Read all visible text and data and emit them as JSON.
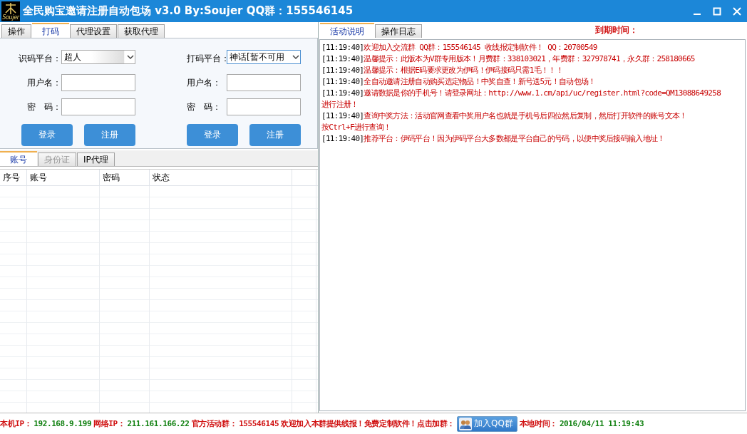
{
  "window": {
    "title": "全民购宝邀请注册自动包场 v3.0 By:Soujer QQ群：155546145",
    "logo_text": "Soujer"
  },
  "left_tabs": [
    {
      "label": "操作",
      "selected": false
    },
    {
      "label": "打码",
      "selected": true
    },
    {
      "label": "代理设置",
      "selected": false
    },
    {
      "label": "获取代理",
      "selected": false
    }
  ],
  "login_panels": [
    {
      "platform_label": "识码平台：",
      "platform_value": "超人",
      "username_label": "用户名：",
      "password_label": "密　码：",
      "buttons": [
        "登录",
        "注册"
      ]
    },
    {
      "platform_label": "打码平台：",
      "platform_value": "神话[暂不可用",
      "username_label": "用户名：",
      "password_label": "密　码：",
      "buttons": [
        "登录",
        "注册"
      ]
    }
  ],
  "record_tabs": [
    {
      "label": "账号",
      "selected": true,
      "disabled": false
    },
    {
      "label": "身份证",
      "selected": false,
      "disabled": true
    },
    {
      "label": "IP代理",
      "selected": false,
      "disabled": false
    }
  ],
  "table": {
    "columns": [
      "序号",
      "账号",
      "密码",
      "状态"
    ]
  },
  "right_tabs": [
    {
      "label": "活动说明",
      "selected": true
    },
    {
      "label": "操作日志",
      "selected": false
    }
  ],
  "expiry_label": "到期时间：",
  "log": [
    {
      "time": "[11:19:40]",
      "lines": [
        "欢迎加入交流群  QQ群：155546145  收线报定制软件！ QQ：20700549"
      ]
    },
    {
      "time": "[11:19:40]",
      "lines": [
        "温馨提示：此版本为V群专用版本！月费群：338103021，年费群：327978741，永久群：258180665"
      ]
    },
    {
      "time": "[11:19:40]",
      "lines": [
        "温馨提示：根据E码要求更改为伊码！伊码接码只需1毛！！！"
      ]
    },
    {
      "time": "[11:19:40]",
      "lines": [
        "全自动邀请注册自动购买选定物品！中奖自查！新号送5元！自动包场！"
      ]
    },
    {
      "time": "[11:19:40]",
      "lines": [
        "邀请数据是你的手机号！请登录网址：http://www.1.cm/api/uc/register.html?code=QM13088649258",
        "进行注册！"
      ]
    },
    {
      "time": "[11:19:40]",
      "lines": [
        "查询中奖方法：活动官网查看中奖用户名也就是手机号后四位然后复制，然后打开软件的账号文本！",
        "按Ctrl+F进行查询！"
      ]
    },
    {
      "time": "[11:19:40]",
      "lines": [
        "推荐平台：伊码平台！因为伊码平台大多数都是平台自己的号码，以便中奖后接码输入地址！"
      ]
    }
  ],
  "status_bar": {
    "items": [
      {
        "kind": "label",
        "text": "本机IP："
      },
      {
        "kind": "value",
        "text": "192.168.9.199"
      },
      {
        "kind": "label",
        "text": "网络IP："
      },
      {
        "kind": "value",
        "text": "211.161.166.22"
      },
      {
        "kind": "label",
        "text": "官方活动群："
      },
      {
        "kind": "label",
        "text": "155546145"
      },
      {
        "kind": "label",
        "text": "欢迎加入本群提供线报！免费定制软件！点击加群："
      },
      {
        "kind": "button",
        "text": "加入QQ群"
      },
      {
        "kind": "label",
        "text": "本地时间："
      },
      {
        "kind": "value",
        "text": "2016/04/11 11:19:43"
      }
    ]
  }
}
